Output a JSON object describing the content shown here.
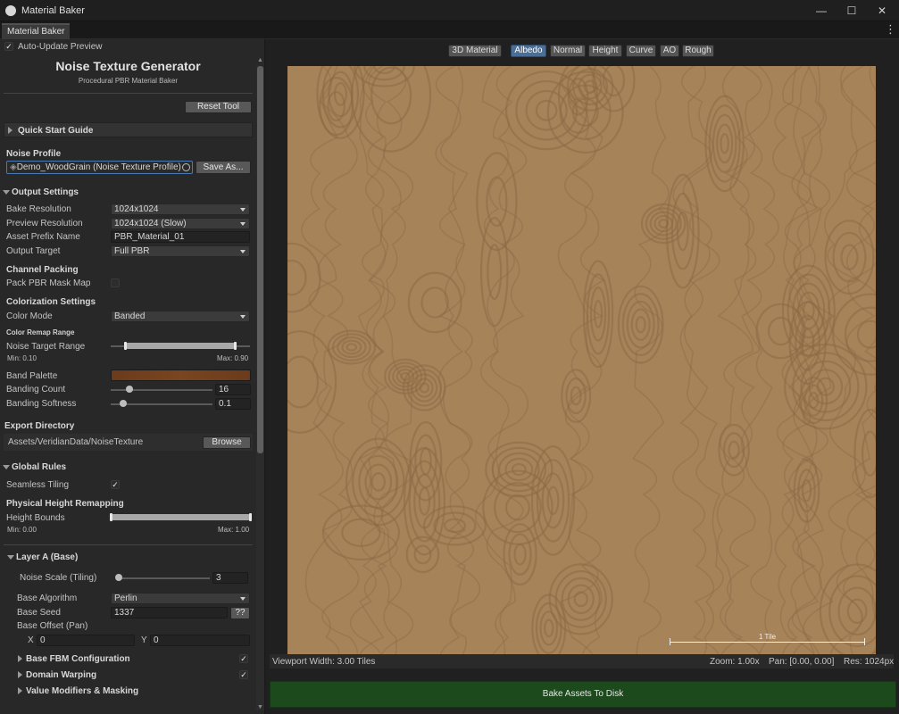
{
  "window": {
    "title": "Material Baker",
    "tab": "Material Baker"
  },
  "panel": {
    "auto_update": {
      "label": "Auto-Update Preview",
      "checked": true
    },
    "title": "Noise Texture Generator",
    "subtitle": "Procedural PBR Material Baker",
    "reset_label": "Reset Tool",
    "quick_start": "Quick Start Guide",
    "noise_profile": {
      "header": "Noise Profile",
      "value": "Demo_WoodGrain (Noise Texture Profile)",
      "save_label": "Save As..."
    },
    "output": {
      "header": "Output Settings",
      "bake_resolution": {
        "label": "Bake Resolution",
        "value": "1024x1024"
      },
      "preview_resolution": {
        "label": "Preview Resolution",
        "value": "1024x1024 (Slow)"
      },
      "asset_prefix": {
        "label": "Asset Prefix Name",
        "value": "PBR_Material_01"
      },
      "output_target": {
        "label": "Output Target",
        "value": "Full PBR"
      }
    },
    "channel": {
      "header": "Channel Packing",
      "pack_label": "Pack PBR Mask Map",
      "pack_checked": false
    },
    "colorization": {
      "header": "Colorization Settings",
      "color_mode": {
        "label": "Color Mode",
        "value": "Banded"
      },
      "remap_header": "Color Remap Range",
      "target_label": "Noise Target Range",
      "min_label": "Min: 0.10",
      "max_label": "Max: 0.90",
      "range_min": 0.1,
      "range_max": 0.9,
      "band_palette_label": "Band Palette",
      "band_palette_color": "#6b3b1b",
      "banding_count": {
        "label": "Banding Count",
        "value": "16"
      },
      "banding_softness": {
        "label": "Banding Softness",
        "value": "0.1"
      }
    },
    "export": {
      "header": "Export Directory",
      "path": "Assets/VeridianData/NoiseTexture",
      "browse_label": "Browse"
    },
    "global": {
      "header": "Global Rules",
      "seamless_label": "Seamless Tiling",
      "seamless_checked": true
    },
    "height": {
      "header": "Physical Height Remapping",
      "bounds_label": "Height Bounds",
      "min_label": "Min: 0.00",
      "max_label": "Max: 1.00",
      "range_min": 0.0,
      "range_max": 1.0
    },
    "layer_a": {
      "header": "Layer A (Base)",
      "noise_scale": {
        "label": "Noise Scale (Tiling)",
        "value": "3"
      },
      "algorithm": {
        "label": "Base Algorithm",
        "value": "Perlin"
      },
      "seed": {
        "label": "Base Seed",
        "value": "1337",
        "random_label": "??"
      },
      "offset": {
        "label": "Base Offset (Pan)",
        "x_label": "X",
        "x": "0",
        "y_label": "Y",
        "y": "0"
      },
      "fbm_label": "Base FBM Configuration",
      "fbm_checked": true,
      "warp_label": "Domain Warping",
      "warp_checked": true,
      "modifiers_label": "Value Modifiers & Masking"
    }
  },
  "viewport": {
    "tabs": [
      "3D Material",
      "Albedo",
      "Normal",
      "Height",
      "Curve",
      "AO",
      "Rough"
    ],
    "active_tab": "Albedo",
    "tile_label": "1 Tile",
    "width_label": "Viewport Width: 3.00 Tiles",
    "zoom": "Zoom: 1.00x",
    "pan": "Pan: [0.00, 0.00]",
    "res": "Res: 1024px",
    "bake_label": "Bake Assets To Disk",
    "texture_base_color": "#a78359",
    "texture_line_color": "#8a6a45"
  }
}
